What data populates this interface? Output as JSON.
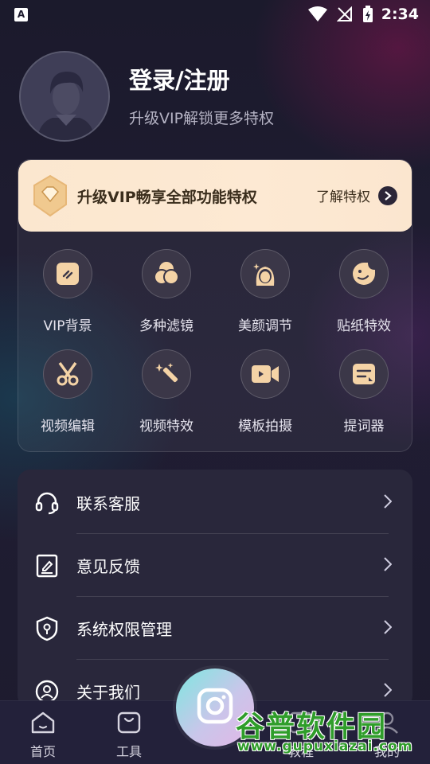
{
  "status_bar": {
    "left_icon_letter": "A",
    "time": "2:34",
    "icons": [
      "wifi-icon",
      "signal-off-icon",
      "battery-charging-icon"
    ]
  },
  "profile": {
    "title": "登录/注册",
    "subtitle": "升级VIP解锁更多特权"
  },
  "vip_card": {
    "banner_text": "升级VIP畅享全部功能特权",
    "learn_more": "了解特权",
    "features": [
      {
        "label": "VIP背景",
        "icon": "vip-background-icon"
      },
      {
        "label": "多种滤镜",
        "icon": "filter-icon"
      },
      {
        "label": "美颜调节",
        "icon": "beauty-icon"
      },
      {
        "label": "贴纸特效",
        "icon": "sticker-icon"
      },
      {
        "label": "视频编辑",
        "icon": "scissors-icon"
      },
      {
        "label": "视频特效",
        "icon": "magic-wand-icon"
      },
      {
        "label": "模板拍摄",
        "icon": "video-camera-icon"
      },
      {
        "label": "提词器",
        "icon": "teleprompter-icon"
      }
    ]
  },
  "menu": {
    "items": [
      {
        "label": "联系客服",
        "icon": "headset-icon"
      },
      {
        "label": "意见反馈",
        "icon": "feedback-icon"
      },
      {
        "label": "系统权限管理",
        "icon": "shield-icon"
      },
      {
        "label": "关于我们",
        "icon": "about-icon"
      }
    ]
  },
  "tabbar": {
    "tabs": [
      {
        "label": "首页",
        "icon": "home-icon"
      },
      {
        "label": "工具",
        "icon": "bag-icon"
      },
      {
        "label": "",
        "icon": "camera-icon"
      },
      {
        "label": "教程",
        "icon": "tutorial-icon"
      },
      {
        "label": "我的",
        "icon": "profile-icon"
      }
    ]
  },
  "watermark": {
    "title": "谷普软件园",
    "url": "www.gupuxiazai.com"
  },
  "colors": {
    "background": "#1c1a2e",
    "vip_banner": "#fbe7cf",
    "menu_card": "#29273b",
    "watermark_green": "#2f9d2a"
  }
}
